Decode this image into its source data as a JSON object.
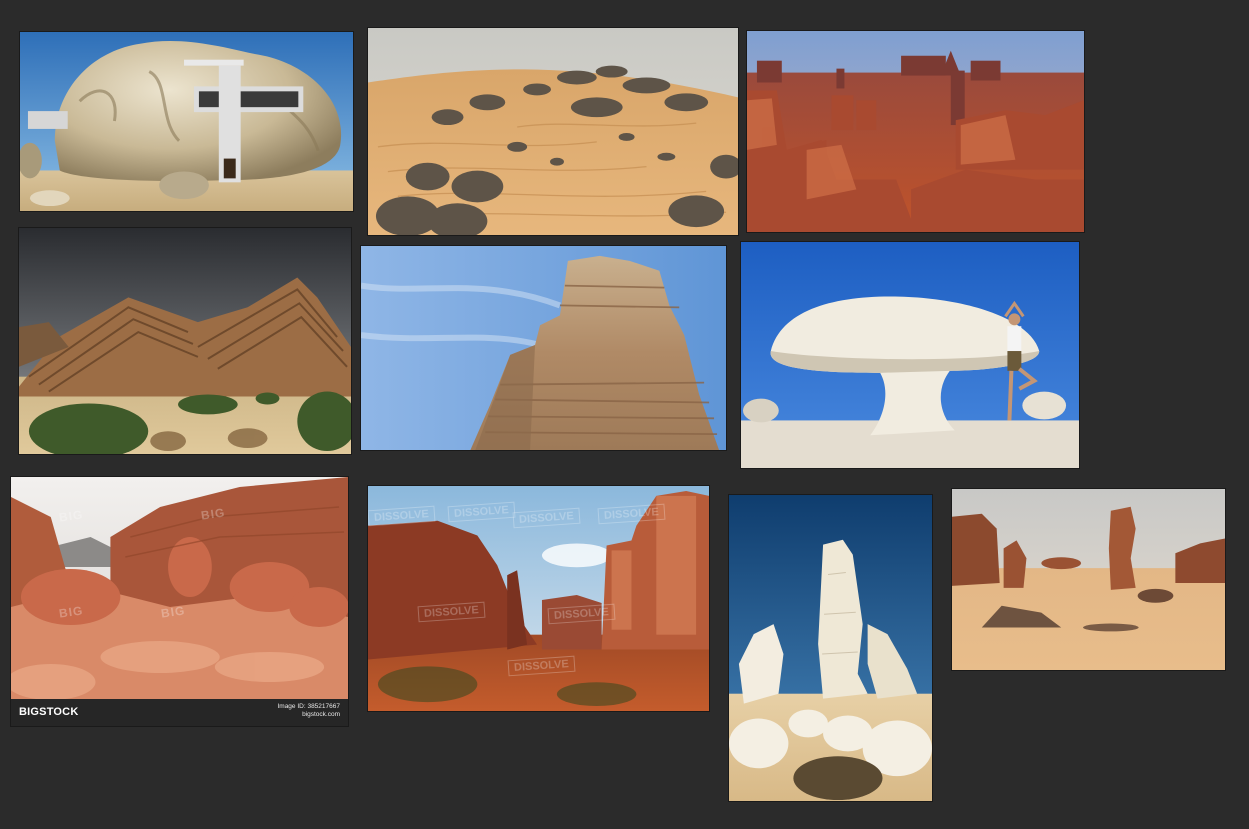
{
  "board": {
    "background": "#2b2b2b",
    "tiles": [
      {
        "name": "rock-house",
        "subject": "modern house built into boulder"
      },
      {
        "name": "rocky-dunes",
        "subject": "dark rocks on rippled sand"
      },
      {
        "name": "monument-valley",
        "subject": "red mesas and buttes"
      },
      {
        "name": "tilted-strata",
        "subject": "tilted sandstone slabs under storm sky"
      },
      {
        "name": "sandstone-butte",
        "subject": "layered sandstone pillar"
      },
      {
        "name": "white-desert-yoga",
        "subject": "person in tree pose on white chalk mushroom rock"
      },
      {
        "name": "red-canyon-stock",
        "subject": "red rock canyon stock photo"
      },
      {
        "name": "arches-canyon",
        "subject": "canyon with red cliffs"
      },
      {
        "name": "white-chalk-spires",
        "subject": "white chalk rock spires"
      },
      {
        "name": "desert-hoodoos",
        "subject": "eroded rock pillars in desert"
      }
    ]
  },
  "watermarks": {
    "bigstock_logo": "BIGSTOCK",
    "bigstock_id": "Image ID: 385217667",
    "bigstock_site": "bigstock.com",
    "bigstock_ghost": "BIG",
    "dissolve_ghost": "DISSOLVE"
  }
}
